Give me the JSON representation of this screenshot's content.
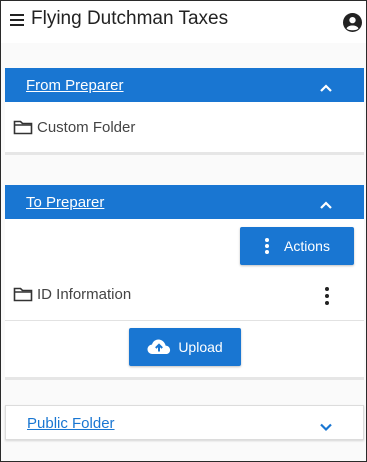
{
  "app": {
    "title": "Flying Dutchman Taxes"
  },
  "sections": {
    "from_preparer": {
      "title": "From Preparer",
      "expanded": true,
      "folders": [
        {
          "name": "Custom Folder"
        }
      ]
    },
    "to_preparer": {
      "title": "To Preparer",
      "expanded": true,
      "actions_label": "Actions",
      "folders": [
        {
          "name": "ID Information"
        }
      ],
      "upload_label": "Upload"
    },
    "public_folder": {
      "title": "Public Folder",
      "expanded": false
    }
  },
  "colors": {
    "accent": "#1976d2",
    "header_text": "#ffffff",
    "background": "#fafafa"
  },
  "icons": {
    "menu": "hamburger-menu-icon",
    "account": "account-circle-icon",
    "collapse": "chevron-up-icon",
    "expand": "chevron-down-icon",
    "folder": "folder-outline-icon",
    "more": "more-vertical-icon",
    "upload": "cloud-upload-icon"
  }
}
